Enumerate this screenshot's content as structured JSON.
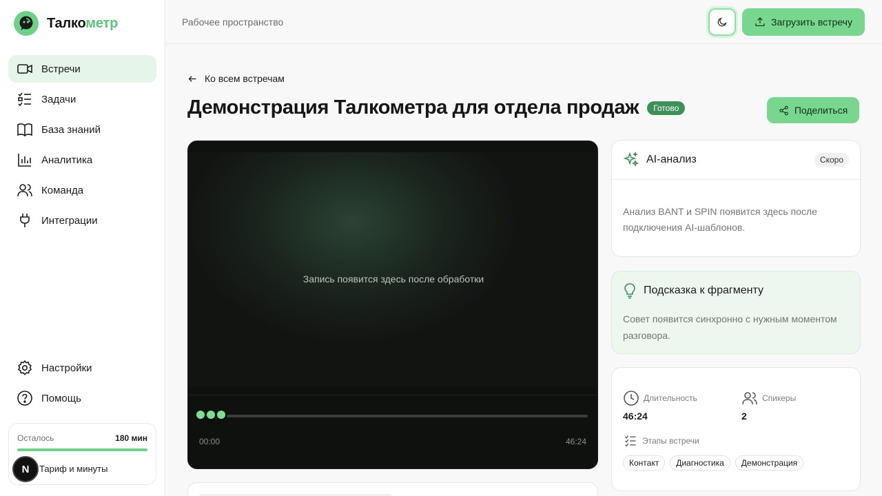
{
  "app": {
    "logo_part1": "Талко",
    "logo_part2": "метр",
    "brand_color": "#6fd08a"
  },
  "sidebar": {
    "items": [
      {
        "label": "Встречи",
        "icon": "video-icon",
        "active": true
      },
      {
        "label": "Задачи",
        "icon": "checklist-icon"
      },
      {
        "label": "База знаний",
        "icon": "book-icon"
      },
      {
        "label": "Аналитика",
        "icon": "bar-chart-icon"
      },
      {
        "label": "Команда",
        "icon": "users-icon"
      },
      {
        "label": "Интеграции",
        "icon": "plug-icon"
      }
    ],
    "bottom": [
      {
        "label": "Настройки",
        "icon": "gear-icon"
      },
      {
        "label": "Помощь",
        "icon": "help-icon"
      }
    ],
    "plan": {
      "remaining_label": "Осталось",
      "remaining_value": "180 мин",
      "progress_fraction": 1.0,
      "link_label": "Тариф и минуты"
    },
    "avatar_letter": "N"
  },
  "header": {
    "workspace": "Рабочее пространство",
    "upload_label": "Загрузить встречу"
  },
  "page": {
    "back_label": "Ко всем встречам",
    "title": "Демонстрация Талкометра для отдела продаж",
    "status_badge": "Готово",
    "share_label": "Поделиться"
  },
  "player": {
    "placeholder": "Запись появится здесь после обработки",
    "time_start": "00:00",
    "time_end": "46:24"
  },
  "ai_card": {
    "title": "AI-анализ",
    "badge": "Скоро",
    "body": "Анализ BANT и SPIN появится здесь после подключения AI-шаблонов."
  },
  "tip_card": {
    "title": "Подсказка к фрагменту",
    "body": "Совет появится синхронно с нужным моментом разговора."
  },
  "stats": {
    "duration_label": "Длительность",
    "duration_value": "46:24",
    "speakers_label": "Спикеры",
    "speakers_value": "2",
    "stages_label": "Этапы встречи",
    "stages": [
      "Контакт",
      "Диагностика",
      "Демонстрация"
    ]
  }
}
